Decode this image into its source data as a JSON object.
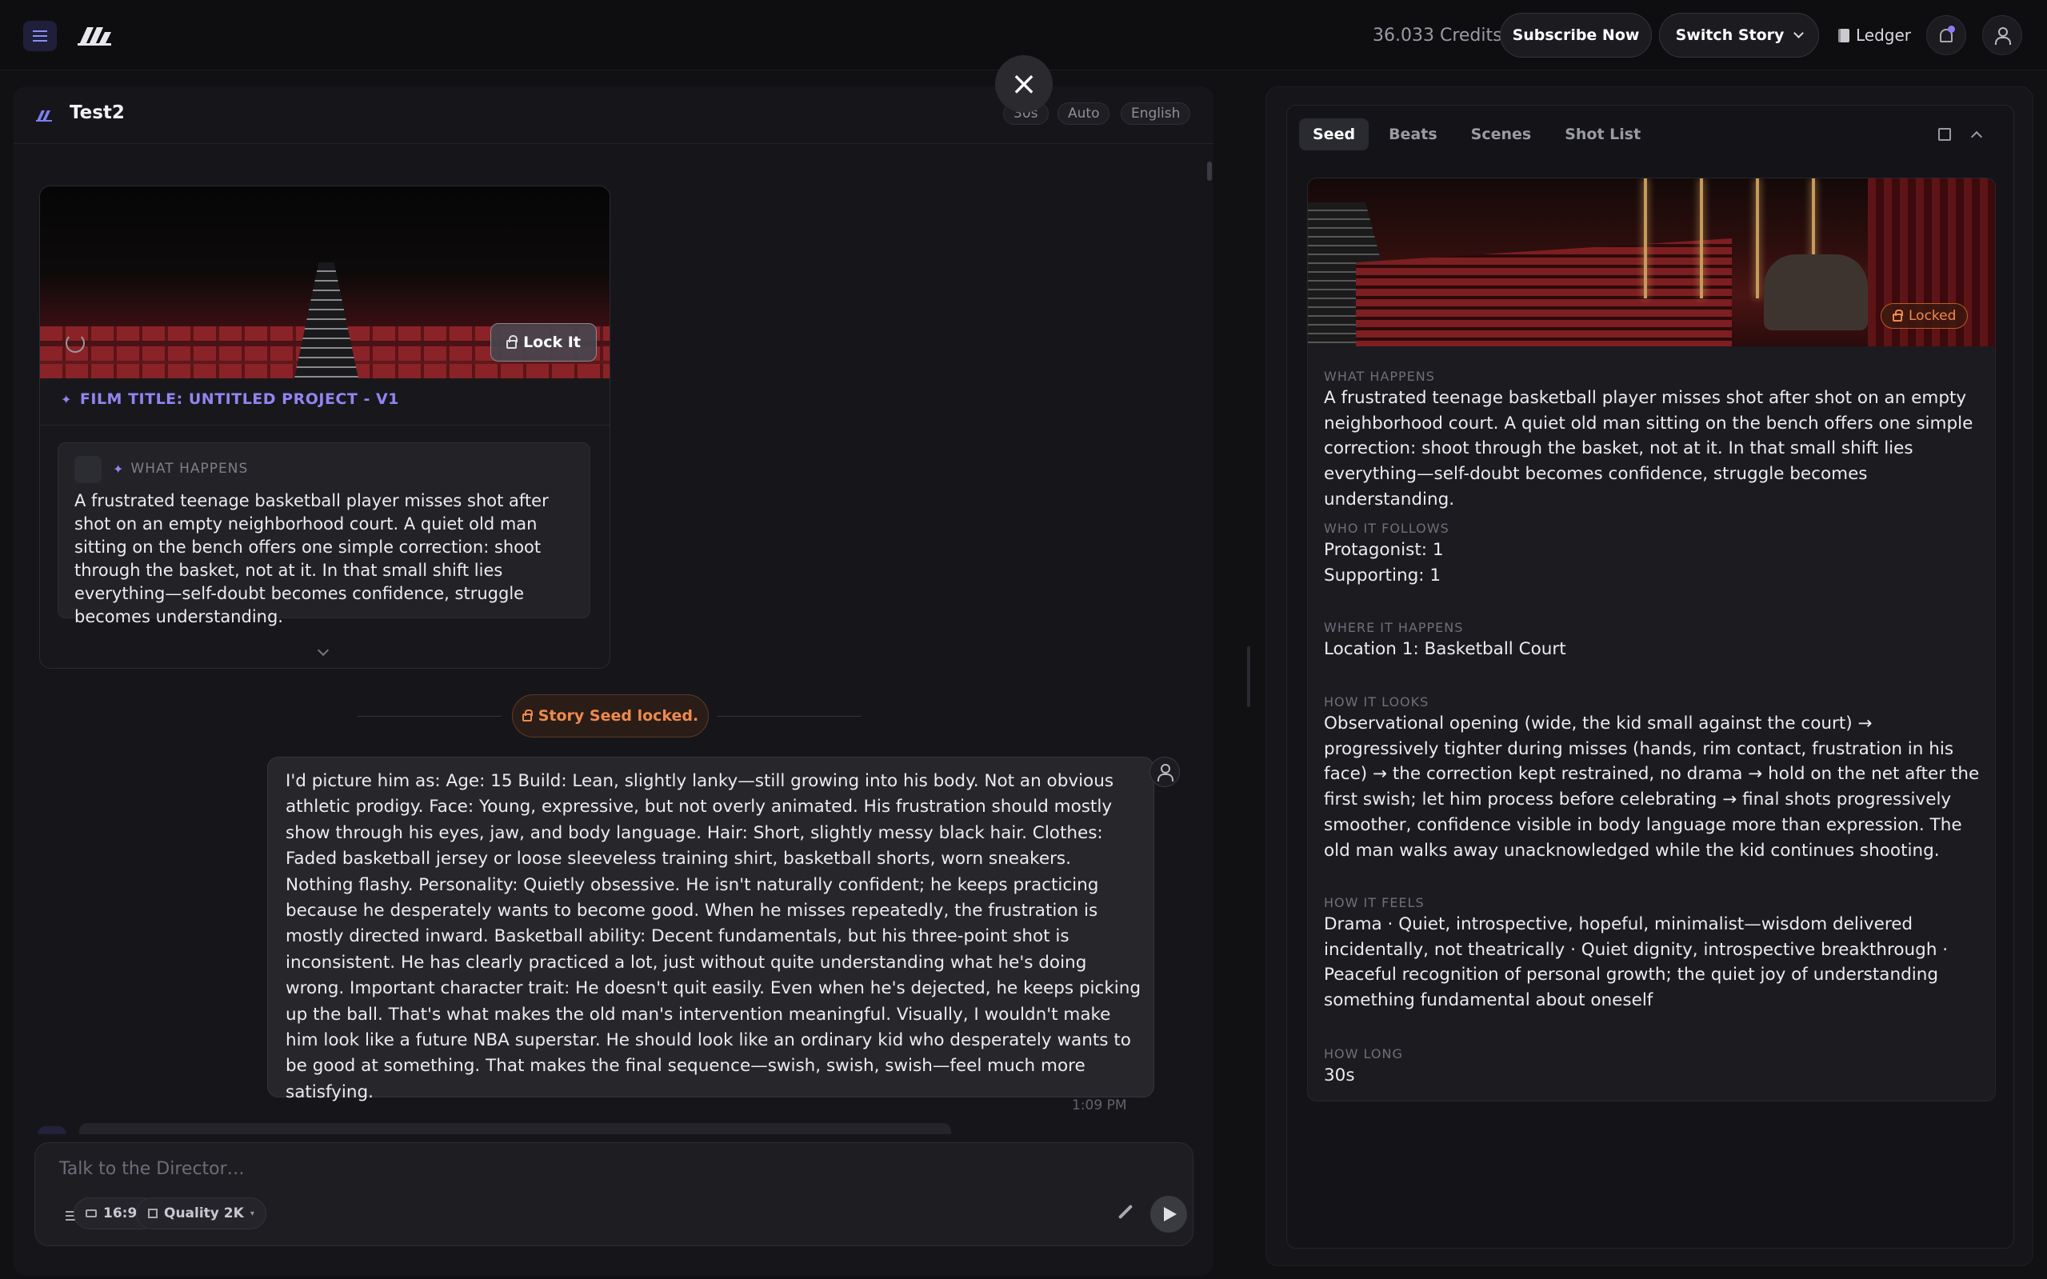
{
  "topbar": {
    "credits": "36.033 Credits",
    "subscribe_label": "Subscribe Now",
    "switch_label": "Switch Story",
    "ledger_label": "Ledger"
  },
  "left": {
    "title": "Test2",
    "tags": [
      "30s",
      "Auto",
      "English"
    ],
    "card": {
      "lock_label": "Lock It",
      "film_title": "FILM TITLE: UNTITLED PROJECT - V1",
      "what_happens_label": "WHAT HAPPENS",
      "what_happens_text": "A frustrated teenage basketball player misses shot after shot on an empty neighborhood court. A quiet old man sitting on the bench offers one simple correction: shoot through the basket, not at it. In that small shift lies everything—self-doubt becomes confidence, struggle becomes understanding."
    },
    "seed_locked": "Story Seed locked.",
    "message": {
      "text": "I'd picture him as: Age: 15 Build: Lean, slightly lanky—still growing into his body. Not an obvious athletic prodigy. Face: Young, expressive, but not overly animated. His frustration should mostly show through his eyes, jaw, and body language. Hair: Short, slightly messy black hair. Clothes: Faded basketball jersey or loose sleeveless training shirt, basketball shorts, worn sneakers. Nothing flashy. Personality: Quietly obsessive. He isn't naturally confident; he keeps practicing because he desperately wants to become good. When he misses repeatedly, the frustration is mostly directed inward. Basketball ability: Decent fundamentals, but his three-point shot is inconsistent. He has clearly practiced a lot, just without quite understanding what he's doing wrong. Important character trait: He doesn't quit easily. Even when he's dejected, he keeps picking up the ball. That's what makes the old man's intervention meaningful. Visually, I wouldn't make him look like a future NBA superstar. He should look like an ordinary kid who desperately wants to be good at something. That makes the final sequence—swish, swish, swish—feel much more satisfying.",
      "time": "1:09 PM"
    },
    "composer": {
      "placeholder": "Talk to the Director…",
      "aspect": "16:9",
      "quality": "Quality 2K"
    }
  },
  "right": {
    "tabs": [
      "Seed",
      "Beats",
      "Scenes",
      "Shot List"
    ],
    "active_tab": "Seed",
    "locked_label": "Locked",
    "fields": [
      {
        "label": "WHAT HAPPENS",
        "value": "A frustrated teenage basketball player misses shot after shot on an empty neighborhood court. A quiet old man sitting on the bench offers one simple correction: shoot through the basket, not at it. In that small shift lies everything—self-doubt becomes confidence, struggle becomes understanding."
      },
      {
        "label": "WHO IT FOLLOWS",
        "value": "Protagonist: 1\nSupporting: 1"
      },
      {
        "label": "WHERE IT HAPPENS",
        "value": "Location 1: Basketball Court"
      },
      {
        "label": "HOW IT LOOKS",
        "value": "Observational opening (wide, the kid small against the court) → progressively tighter during misses (hands, rim contact, frustration in his face) → the correction kept restrained, no drama → hold on the net after the first swish; let him process before celebrating → final shots progressively smoother, confidence visible in body language more than expression. The old man walks away unacknowledged while the kid continues shooting."
      },
      {
        "label": "HOW IT FEELS",
        "value": "Drama · Quiet, introspective, hopeful, minimalist—wisdom delivered incidentally, not theatrically · Quiet dignity, introspective breakthrough · Peaceful recognition of personal growth; the quiet joy of understanding something fundamental about oneself"
      },
      {
        "label": "HOW LONG",
        "value": "30s"
      }
    ]
  }
}
